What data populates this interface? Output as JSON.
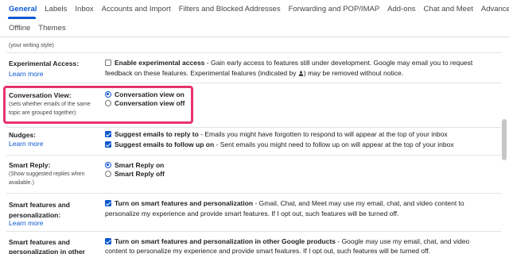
{
  "tabs": {
    "row1": [
      "General",
      "Labels",
      "Inbox",
      "Accounts and Import",
      "Filters and Blocked Addresses",
      "Forwarding and POP/IMAP",
      "Add-ons",
      "Chat and Meet",
      "Advanced"
    ],
    "row2": [
      "Offline",
      "Themes"
    ],
    "active": "General"
  },
  "accent_color": "#0b57d0",
  "highlight_color": "#e8336b",
  "fragment": "your writing style)",
  "experimental": {
    "label": "Experimental Access:",
    "learn_more": "Learn more",
    "option_title": "Enable experimental access",
    "option_desc": " - Gain early access to features still under development. Google may email you to request",
    "line2_pre": "feedback on these features. Experimental features (indicated by ",
    "line2_post": ") may be removed without notice.",
    "checked": false
  },
  "conversation": {
    "label": "Conversation View:",
    "sublabel": "(sets whether emails of the same topic are grouped together)",
    "option_on": "Conversation view on",
    "option_off": "Conversation view off",
    "selected": "on"
  },
  "nudges": {
    "label": "Nudges:",
    "learn_more": "Learn more",
    "opt1_title": "Suggest emails to reply to",
    "opt1_desc": " - Emails you might have forgotten to respond to will appear at the top of your inbox",
    "opt2_title": "Suggest emails to follow up on",
    "opt2_desc": " - Sent emails you might need to follow up on will appear at the top of your inbox"
  },
  "smart_reply": {
    "label": "Smart Reply:",
    "sublabel": "(Show suggested replies when available.)",
    "option_on": "Smart Reply on",
    "option_off": "Smart Reply off",
    "selected": "on"
  },
  "smart_features": {
    "label": "Smart features and personalization:",
    "learn_more": "Learn more",
    "option_title": "Turn on smart features and personalization",
    "option_desc": " - Gmail, Chat, and Meet may use my email, chat, and video content to",
    "line2": "personalize my experience and provide smart features. If I opt out, such features will be turned off."
  },
  "smart_other": {
    "label_line1": "Smart features and",
    "label_line2": "personalization in other",
    "option_title": "Turn on smart features and personalization in other Google products",
    "option_desc": " - Google may use my email, chat, and video",
    "line2": "content to personalize my experience and provide smart features. If I opt out, such features will be turned off."
  }
}
